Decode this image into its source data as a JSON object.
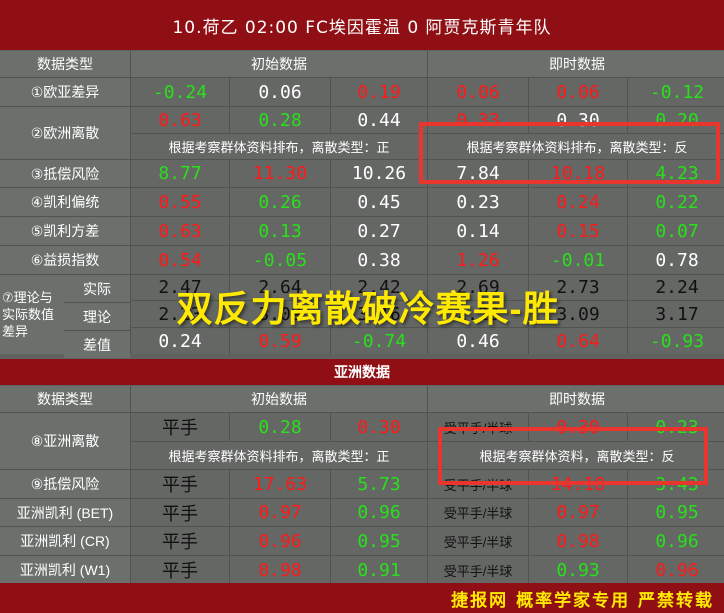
{
  "header": {
    "title": "10.荷乙  02:00  FC埃因霍温 0 阿贾克斯青年队"
  },
  "euro": {
    "col_type": "数据类型",
    "col_initial": "初始数据",
    "col_live": "即时数据",
    "rows": {
      "r1": {
        "label": "①欧亚差异",
        "vals": [
          "-0.24",
          "0.06",
          "0.19",
          "0.06",
          "0.06",
          "-0.12"
        ]
      },
      "r2": {
        "label": "②欧洲离散",
        "vals": [
          "0.63",
          "0.28",
          "0.44",
          "0.33",
          "0.30",
          "0.20"
        ],
        "note_initial": "根据考察群体资料排布，离散类型：正",
        "note_live": "根据考察群体资料排布，离散类型：反"
      },
      "r3": {
        "label": "③抵偿风险",
        "vals": [
          "8.77",
          "11.30",
          "10.26",
          "7.84",
          "10.18",
          "4.23"
        ]
      },
      "r4": {
        "label": "④凯利偏统",
        "vals": [
          "0.55",
          "0.26",
          "0.45",
          "0.23",
          "0.24",
          "0.22"
        ]
      },
      "r5": {
        "label": "⑤凯利方差",
        "vals": [
          "0.63",
          "0.13",
          "0.27",
          "0.14",
          "0.15",
          "0.07"
        ]
      },
      "r6": {
        "label": "⑥益损指数",
        "vals": [
          "0.54",
          "-0.05",
          "0.38",
          "1.26",
          "-0.01",
          "0.78"
        ]
      },
      "r7": {
        "label": "⑦理论与实际数值差异",
        "sub_actual": "实际",
        "sub_theory": "理论",
        "sub_diff": "差值",
        "actual": [
          "2.47",
          "2.64",
          "2.42",
          "2.69",
          "2.73",
          "2.24"
        ],
        "theory": [
          "2.23",
          "3.09",
          "3.16",
          "2.23",
          "3.09",
          "3.17"
        ],
        "diff": [
          "0.24",
          "0.59",
          "-0.74",
          "0.46",
          "0.64",
          "-0.93"
        ]
      }
    }
  },
  "asia_section": "亚洲数据",
  "asia": {
    "col_type": "数据类型",
    "col_initial": "初始数据",
    "col_live": "即时数据",
    "r8": {
      "label": "⑧亚洲离散",
      "init": [
        "平手",
        "0.28",
        "0.30"
      ],
      "live": [
        "受平手/半球",
        "0.30",
        "0.23"
      ],
      "note_initial": "根据考察群体资料排布，离散类型：正",
      "note_live": "根据考察群体资料，离散类型：反"
    },
    "r9": {
      "label": "⑨抵偿风险",
      "init": [
        "平手",
        "17.63",
        "5.73"
      ],
      "live": [
        "受平手/半球",
        "14.18",
        "3.43"
      ]
    },
    "bet": {
      "label": "亚洲凯利 (BET)",
      "init": [
        "平手",
        "0.97",
        "0.96"
      ],
      "live": [
        "受平手/半球",
        "0.97",
        "0.95"
      ]
    },
    "cr": {
      "label": "亚洲凯利 (CR)",
      "init": [
        "平手",
        "0.96",
        "0.95"
      ],
      "live": [
        "受平手/半球",
        "0.98",
        "0.96"
      ]
    },
    "w1": {
      "label": "亚洲凯利 (W1)",
      "init": [
        "平手",
        "0.98",
        "0.91"
      ],
      "live": [
        "受平手/半球",
        "0.93",
        "0.96"
      ]
    }
  },
  "overlay_text": "双反力离散破冷赛果-胜",
  "footer": {
    "text": "捷报网 概率学家专用 严禁转载"
  },
  "colors": {
    "brand_red": "#8f0f14",
    "value_red": "#ff1a1a",
    "value_green": "#29e01b",
    "overlay_yellow": "#ffe900",
    "highlight_box": "#e8352e"
  }
}
